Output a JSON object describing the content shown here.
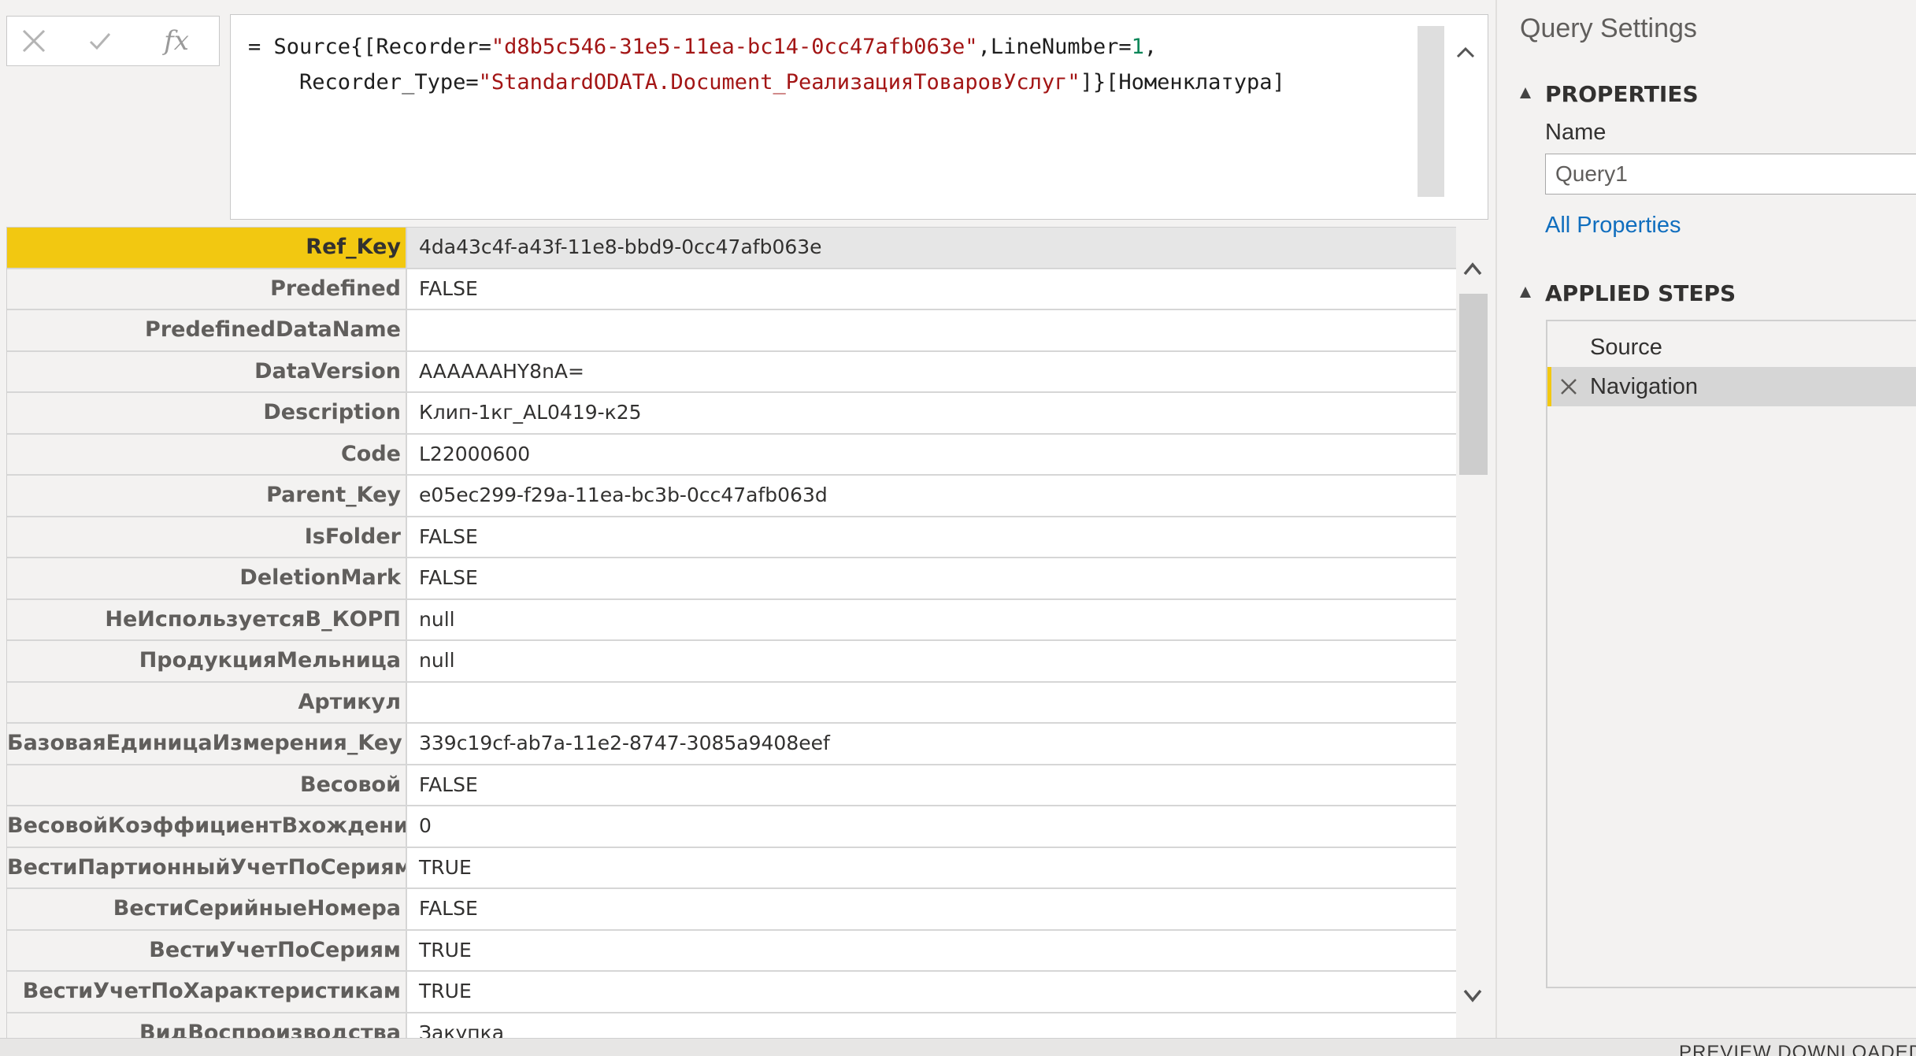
{
  "formula_bar": {
    "cancel_icon": "close-icon",
    "commit_icon": "check-icon",
    "fx_label": "fx",
    "formula": {
      "prefix": "= Source{[Recorder=",
      "recorder_value": "\"d8b5c546-31e5-11ea-bc14-0cc47afb063e\"",
      "line_number_label": ",LineNumber=",
      "line_number_value": "1",
      "comma": ",",
      "recorder_type_label": "    Recorder_Type=",
      "recorder_type_value": "\"StandardODATA.Document_РеализацияТоваровУслуг\"",
      "suffix": "]}[Номенклатура]"
    }
  },
  "record": {
    "selected_field": "Ref_Key",
    "fields": [
      {
        "key": "Ref_Key",
        "value": "4da43c4f-a43f-11e8-bbd9-0cc47afb063e"
      },
      {
        "key": "Predefined",
        "value": "FALSE"
      },
      {
        "key": "PredefinedDataName",
        "value": ""
      },
      {
        "key": "DataVersion",
        "value": "AAAAAAHY8nA="
      },
      {
        "key": "Description",
        "value": "Клип-1кг_AL0419-к25"
      },
      {
        "key": "Code",
        "value": "L22000600"
      },
      {
        "key": "Parent_Key",
        "value": "e05ec299-f29a-11ea-bc3b-0cc47afb063d"
      },
      {
        "key": "IsFolder",
        "value": "FALSE"
      },
      {
        "key": "DeletionMark",
        "value": "FALSE"
      },
      {
        "key": "НеИспользуетсяВ_КОРП",
        "value": "null"
      },
      {
        "key": "ПродукцияМельница",
        "value": "null"
      },
      {
        "key": "Артикул",
        "value": ""
      },
      {
        "key": "БазоваяЕдиницаИзмерения_Key",
        "value": "339c19cf-ab7a-11e2-8747-3085a9408eef"
      },
      {
        "key": "Весовой",
        "value": "FALSE"
      },
      {
        "key": "ВесовойКоэффициентВхождения",
        "value": "0"
      },
      {
        "key": "ВестиПартионныйУчетПоСериям",
        "value": "TRUE"
      },
      {
        "key": "ВестиСерийныеНомера",
        "value": "FALSE"
      },
      {
        "key": "ВестиУчетПоСериям",
        "value": "TRUE"
      },
      {
        "key": "ВестиУчетПоХарактеристикам",
        "value": "TRUE"
      },
      {
        "key": "ВидВоспроизводства",
        "value": "Закупка"
      }
    ]
  },
  "query_settings": {
    "title": "Query Settings",
    "properties_heading": "PROPERTIES",
    "name_label": "Name",
    "name_value": "Query1",
    "all_properties_link": "All Properties",
    "applied_steps_heading": "APPLIED STEPS",
    "steps": [
      {
        "label": "Source",
        "active": false
      },
      {
        "label": "Navigation",
        "active": true
      }
    ]
  },
  "status_bar": {
    "text": "PREVIEW DOWNLOADED"
  },
  "colors": {
    "selected_key_bg": "#f2c811",
    "link": "#106ebe",
    "string_literal": "#a31515",
    "number_literal": "#098658"
  }
}
